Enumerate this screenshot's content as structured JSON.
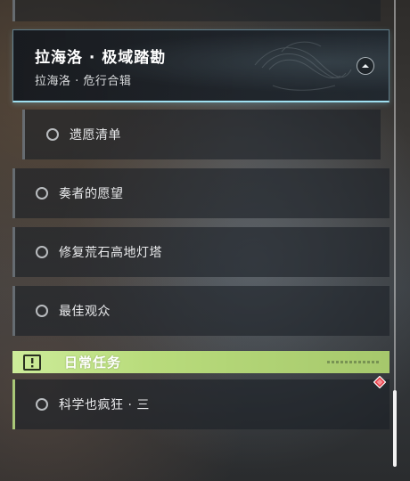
{
  "quest_group": {
    "title": "拉海洛 · 极域踏勘",
    "subtitle": "拉海洛 · 危行合辑",
    "collapse_icon": "chevron-up-icon"
  },
  "quests": [
    {
      "label": "遗愿清单",
      "status_icon": "empty-circle-icon"
    },
    {
      "label": "奏者的愿望",
      "status_icon": "empty-circle-icon"
    },
    {
      "label": "修复荒石高地灯塔",
      "status_icon": "empty-circle-icon"
    },
    {
      "label": "最佳观众",
      "status_icon": "empty-circle-icon"
    }
  ],
  "daily_section": {
    "title": "日常任务",
    "icon": "alert-icon",
    "color": "#c3e38a",
    "items": [
      {
        "label": "科学也疯狂 · 三",
        "status_icon": "empty-circle-icon",
        "badge_icon": "red-diamond-icon"
      }
    ]
  },
  "colors": {
    "header_accent": "#9fe0f0",
    "daily_accent": "#b9dc7c",
    "alert_badge": "#e8404a"
  }
}
